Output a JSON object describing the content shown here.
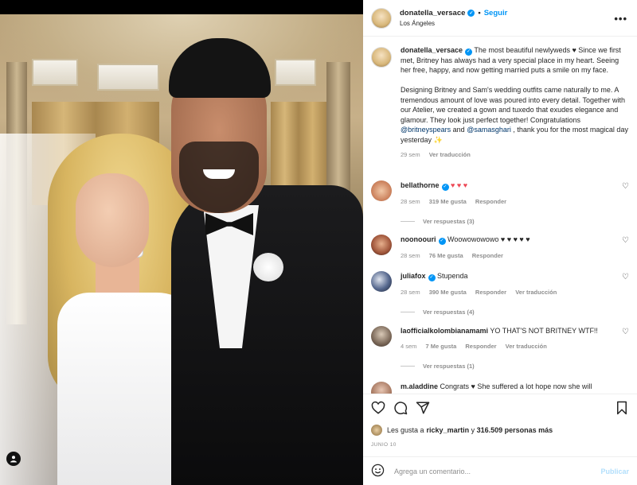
{
  "post": {
    "author": "donatella_versace",
    "follow_label": "Seguir",
    "location": "Los Ángeles",
    "more_label": "•••"
  },
  "caption": {
    "author": "donatella_versace",
    "p1": "The most beautiful newlyweds ♥ Since we first met, Britney has always had a very special place in my heart. Seeing her free, happy, and now getting married puts a smile on my face.",
    "p2_a": "Designing Britney and Sam's wedding outfits came naturally to me. A tremendous amount of love was poured into every detail. Together with our Atelier, we created a gown and tuxedo that exudes elegance and glamour. They look just perfect together! Congratulations ",
    "mention1": "@britneyspears",
    "p2_and": " and ",
    "mention2": "@samasghari",
    "p2_b": " , thank you for the most magical day yesterday ✨",
    "time": "29 sem",
    "translate": "Ver traducción"
  },
  "comments": [
    {
      "user": "bellathorne",
      "verified": true,
      "text": "♥ ♥ ♥",
      "time": "28 sem",
      "likes": "319 Me gusta",
      "reply": "Responder",
      "translate": "",
      "replies": "Ver respuestas (3)",
      "color": "#e8a07a"
    },
    {
      "user": "noonoouri",
      "verified": true,
      "text": "Woowowowowo ♥ ♥ ♥ ♥ ♥",
      "time": "28 sem",
      "likes": "76 Me gusta",
      "reply": "Responder",
      "translate": "",
      "replies": "",
      "color": "#c0735a"
    },
    {
      "user": "juliafox",
      "verified": true,
      "text": "Stupenda",
      "time": "28 sem",
      "likes": "390 Me gusta",
      "reply": "Responder",
      "translate": "Ver traducción",
      "replies": "Ver respuestas (4)",
      "color": "#4b5a7a"
    },
    {
      "user": "laofficialkolombianamami",
      "verified": false,
      "text": "YO THAT'S NOT BRITNEY WTF!!",
      "time": "4 sem",
      "likes": "7 Me gusta",
      "reply": "Responder",
      "translate": "Ver traducción",
      "replies": "Ver respuestas (1)",
      "color": "#8a7a6a"
    },
    {
      "user": "m.aladdine",
      "verified": false,
      "text": "Congrats ♥ She suffered a lot hope now she will",
      "time": "",
      "likes": "",
      "reply": "",
      "translate": "",
      "replies": "",
      "color": "#b08a78"
    }
  ],
  "actions": {
    "likes_prefix": "Les gusta a ",
    "likes_user": "ricky_martin",
    "likes_suffix": " y ",
    "likes_count": "316.509 personas más",
    "date": "JUNIO 10"
  },
  "composer": {
    "placeholder": "Agrega un comentario...",
    "publish": "Publicar"
  }
}
